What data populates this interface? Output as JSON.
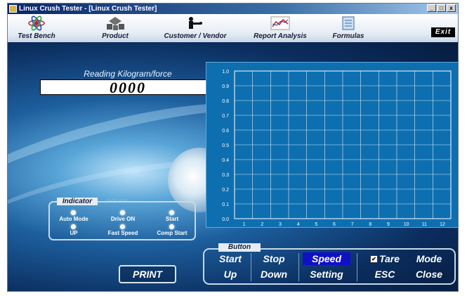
{
  "window": {
    "title": "Linux Crush Tester - [Linux Crush Tester]",
    "controls": {
      "minimize": "_",
      "maximize": "□",
      "close": "x"
    }
  },
  "menu": {
    "items": [
      {
        "label": "Test Bench",
        "icon": "atom-icon"
      },
      {
        "label": "Product",
        "icon": "product-boxes-icon"
      },
      {
        "label": "Customer / Vendor",
        "icon": "handshake-icon"
      },
      {
        "label": "Report Analysis",
        "icon": "report-chart-icon"
      },
      {
        "label": "Formulas",
        "icon": "formula-sheet-icon"
      }
    ],
    "exit_label": "Exit"
  },
  "reading": {
    "label": "Reading Kilogram/force",
    "value": "0000"
  },
  "chart_data": {
    "type": "line",
    "x": [
      1,
      2,
      3,
      4,
      5,
      6,
      7,
      8,
      9,
      10,
      11,
      12
    ],
    "xlim": [
      0,
      12
    ],
    "ylim": [
      0.0,
      1.0
    ],
    "y_ticks": [
      "0.0",
      "0.1",
      "0.2",
      "0.3",
      "0.4",
      "0.5",
      "0.6",
      "0.7",
      "0.8",
      "0.9",
      "1.0"
    ],
    "x_ticks": [
      "1",
      "2",
      "3",
      "4",
      "5",
      "6",
      "7",
      "8",
      "9",
      "10",
      "11",
      "12"
    ],
    "series": [],
    "grid": true,
    "colors": {
      "background": "#0d6fb0",
      "grid": "#ffffff",
      "text": "#ffffff"
    }
  },
  "indicator": {
    "title": "Indicator",
    "faint_title": "Indicator",
    "lights": [
      {
        "label": "Auto Mode"
      },
      {
        "label": "Drive ON"
      },
      {
        "label": "Start"
      },
      {
        "label": "UP"
      },
      {
        "label": "Fast Speed"
      },
      {
        "label": "Comp Start"
      }
    ]
  },
  "print_label": "PRINT",
  "buttons": {
    "title": "Button",
    "start": "Start",
    "stop": "Stop",
    "speed": "Speed",
    "tare": "Tare",
    "tare_checked": true,
    "mode": "Mode",
    "up": "Up",
    "down": "Down",
    "setting": "Setting",
    "esc": "ESC",
    "close": "Close"
  },
  "colors": {
    "title_bar": "#0a246a",
    "active_button": "#1010c8",
    "panel_bg": "#0c2c58"
  }
}
